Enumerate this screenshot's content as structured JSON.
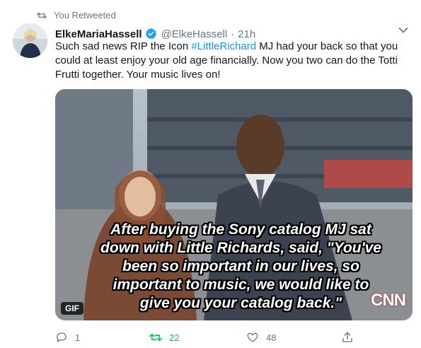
{
  "retweet_context": {
    "label": "You Retweeted"
  },
  "author": {
    "name": "ElkeMariaHassell",
    "handle": "@ElkeHassell",
    "separator": "·",
    "timestamp": "21h"
  },
  "tweet": {
    "text_parts": [
      "Such sad news RIP the Icon ",
      "#LittleRichard",
      " MJ had your back so that you could at least enjoy your old age financially. Now you two can do the Totti Frutti together. Your music lives on!"
    ]
  },
  "media": {
    "badge": "GIF",
    "caption_lines": [
      "After buying the Sony catalog MJ sat",
      "down with Little Richards, said, \"You've",
      "been so important in our lives, so",
      "important to music, we would like to",
      "give you your catalog back.\""
    ],
    "watermark": "CNN"
  },
  "actions": {
    "reply_count": "1",
    "retweet_count": "22",
    "like_count": "48"
  },
  "colors": {
    "link": "#1b95e0",
    "verified": "#1da1f2",
    "retweet_active": "#17bf63",
    "muted": "#657786"
  },
  "icons": [
    "retweet-icon",
    "verified-badge-icon",
    "chevron-down-icon",
    "reply-icon",
    "like-icon",
    "share-icon"
  ]
}
